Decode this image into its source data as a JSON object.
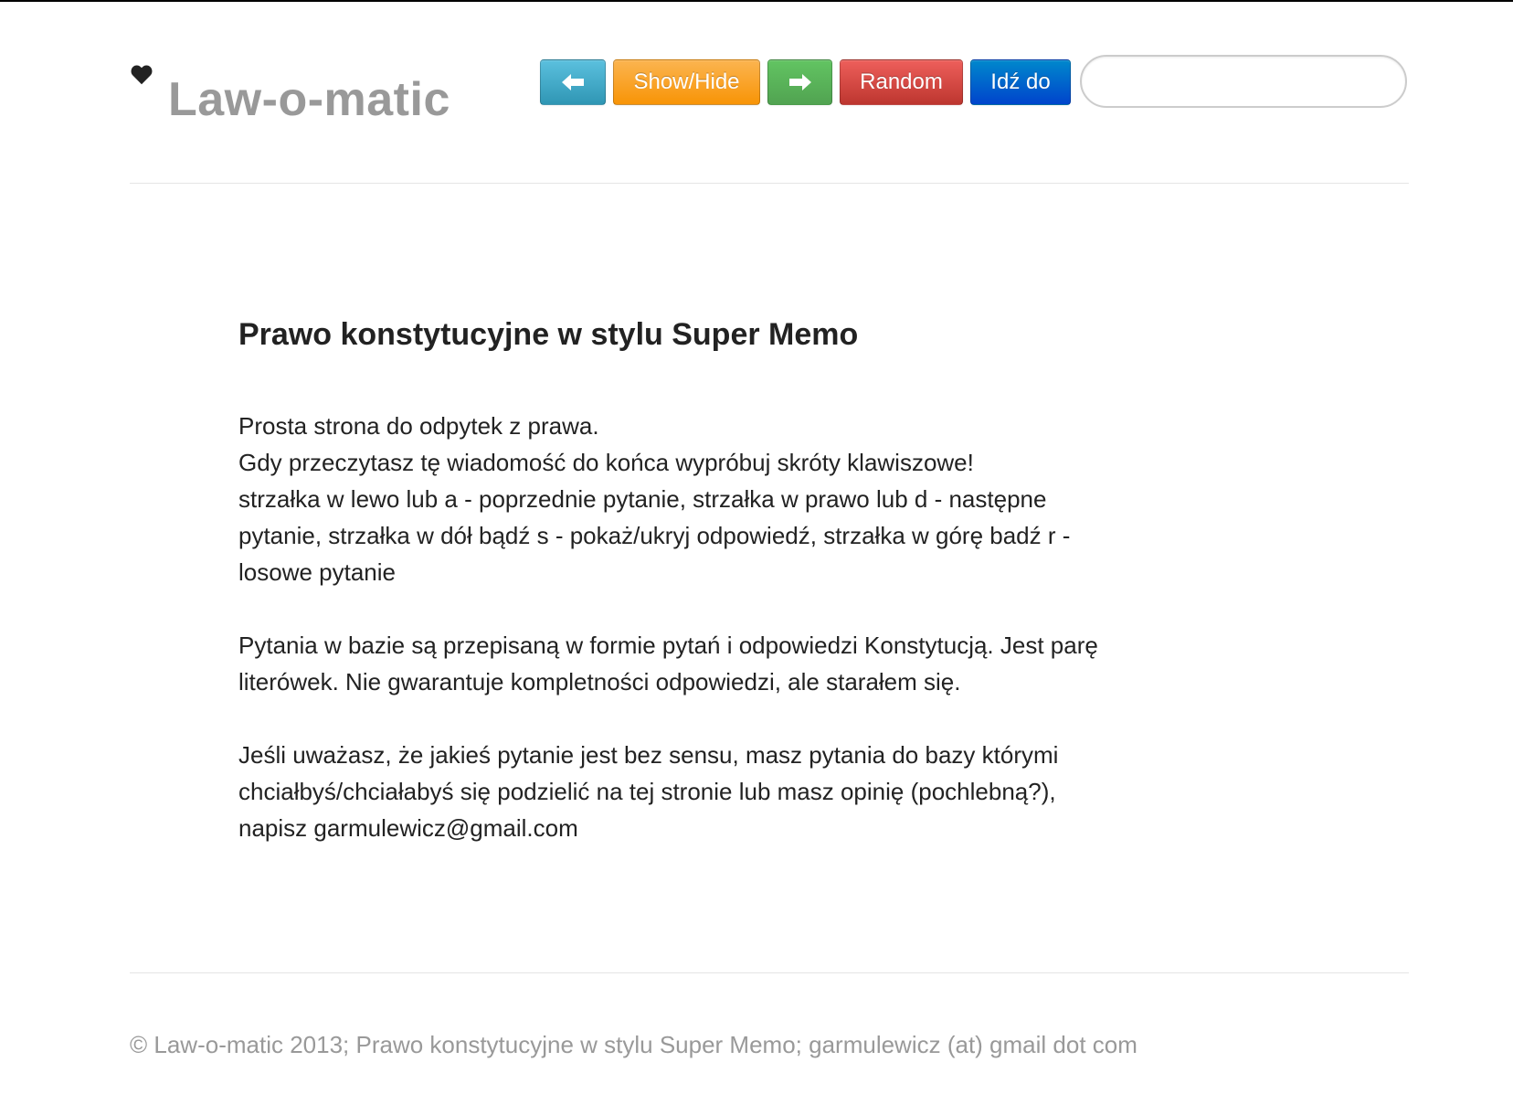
{
  "header": {
    "brand_icon": "heart-icon",
    "brand_title": "Law-o-matic",
    "buttons": {
      "prev_icon": "arrow-left-icon",
      "show_hide_label": "Show/Hide",
      "next_icon": "arrow-right-icon",
      "random_label": "Random",
      "goto_label": "Idź do"
    },
    "search": {
      "value": "",
      "placeholder": ""
    }
  },
  "main": {
    "heading": "Prawo konstytucyjne w stylu Super Memo",
    "paragraph1_lines": [
      "Prosta strona do odpytek z prawa.",
      "Gdy przeczytasz tę wiadomość do końca wypróbuj skróty klawiszowe!",
      "strzałka w lewo lub a - poprzednie pytanie, strzałka w prawo lub d - następne",
      "pytanie, strzałka w dół bądź s - pokaż/ukryj odpowiedź, strzałka w górę badź r -",
      "losowe pytanie"
    ],
    "paragraph2_lines": [
      "Pytania w bazie są przepisaną w formie pytań i odpowiedzi Konstytucją. Jest parę",
      "literówek. Nie gwarantuje kompletności odpowiedzi, ale starałem się."
    ],
    "paragraph3_lines": [
      "Jeśli uważasz, że jakieś pytanie jest bez sensu, masz pytania do bazy którymi",
      "chciałbyś/chciałabyś się podzielić na tej stronie lub masz opinię (pochlebną?),",
      "napisz garmulewicz@gmail.com"
    ]
  },
  "footer": {
    "text": "© Law-o-matic 2013; Prawo konstytucyjne w stylu Super Memo; garmulewicz (at) gmail dot com"
  },
  "colors": {
    "info": "#5bc0de",
    "warning": "#f89406",
    "success": "#51a351",
    "danger": "#bd362f",
    "primary": "#0044cc",
    "brand_text": "#999999"
  }
}
